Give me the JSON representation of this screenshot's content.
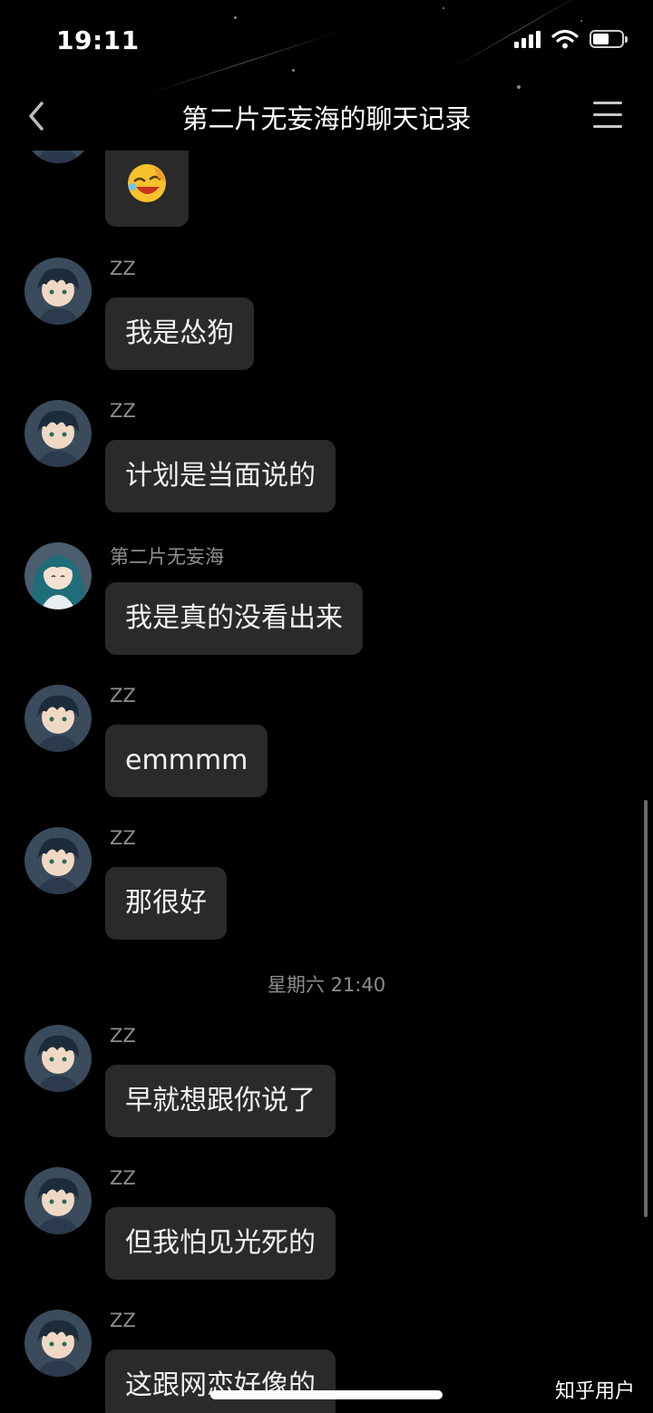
{
  "status_bar": {
    "time": "19:11",
    "battery_level": 0.55,
    "signal_bars": 4
  },
  "nav": {
    "title": "第二片无妄海的聊天记录",
    "back_icon": "chevron-left-icon",
    "menu_icon": "hamburger-menu-icon"
  },
  "messages": [
    {
      "sender": "",
      "text": "",
      "type": "emoji",
      "emoji": "laughing-face-emoji",
      "avatar": "boy-avatar"
    },
    {
      "sender": "ZZ",
      "text": "我是怂狗",
      "type": "text",
      "avatar": "boy-avatar"
    },
    {
      "sender": "ZZ",
      "text": "计划是当面说的",
      "type": "text",
      "avatar": "boy-avatar"
    },
    {
      "sender": "第二片无妄海",
      "text": "我是真的没看出来",
      "type": "text",
      "avatar": "girl-avatar"
    },
    {
      "sender": "ZZ",
      "text": "emmmm",
      "type": "text",
      "avatar": "boy-avatar"
    },
    {
      "sender": "ZZ",
      "text": "那很好",
      "type": "text",
      "avatar": "boy-avatar"
    },
    {
      "sender": "ZZ",
      "text": "早就想跟你说了",
      "type": "text",
      "avatar": "boy-avatar"
    },
    {
      "sender": "ZZ",
      "text": "但我怕见光死的",
      "type": "text",
      "avatar": "boy-avatar"
    },
    {
      "sender": "ZZ",
      "text": "这跟网恋好像的",
      "type": "text",
      "avatar": "boy-avatar"
    }
  ],
  "time_divider": "星期六 21:40",
  "watermark": "知乎用户",
  "colors": {
    "background": "#000000",
    "bubble": "#2a2a2a",
    "secondary_text": "#8e8e8e"
  }
}
